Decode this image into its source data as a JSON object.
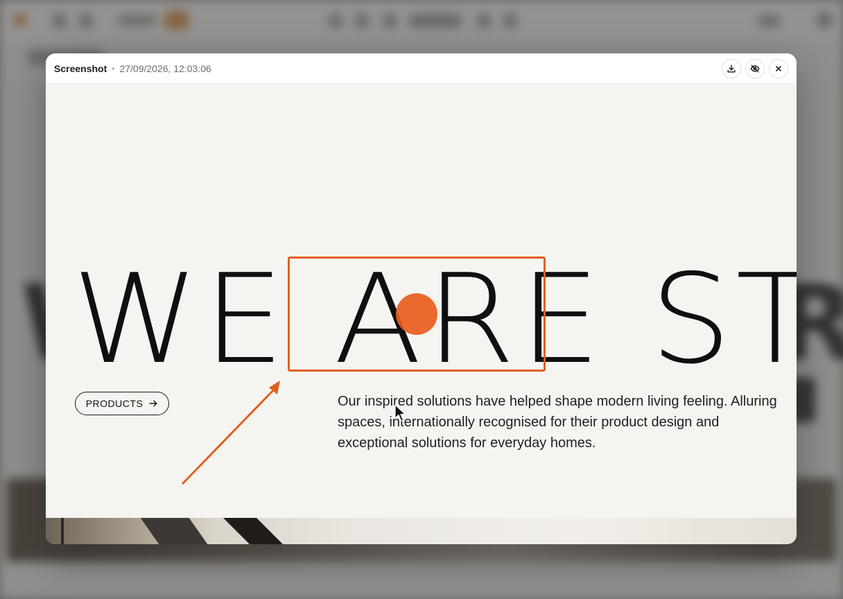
{
  "dialog": {
    "title": "Screenshot",
    "separator": "•",
    "timestamp": "27/09/2026, 12:03:06",
    "actions": [
      {
        "name": "download",
        "icon": "download-icon"
      },
      {
        "name": "hide",
        "icon": "eye-off-icon"
      },
      {
        "name": "close",
        "icon": "close-icon"
      }
    ]
  },
  "page": {
    "hero": "WE ARE STRY",
    "button_label": "PRODUCTS",
    "paragraph": "Our inspired solutions have helped shape modern living feeling. Alluring spaces, internationally recognised for their product design and exceptional solutions for everyday homes."
  },
  "colors": {
    "accent": "#E0601F",
    "text": "#0F0F0F",
    "canvas": "#F6F4F0"
  }
}
